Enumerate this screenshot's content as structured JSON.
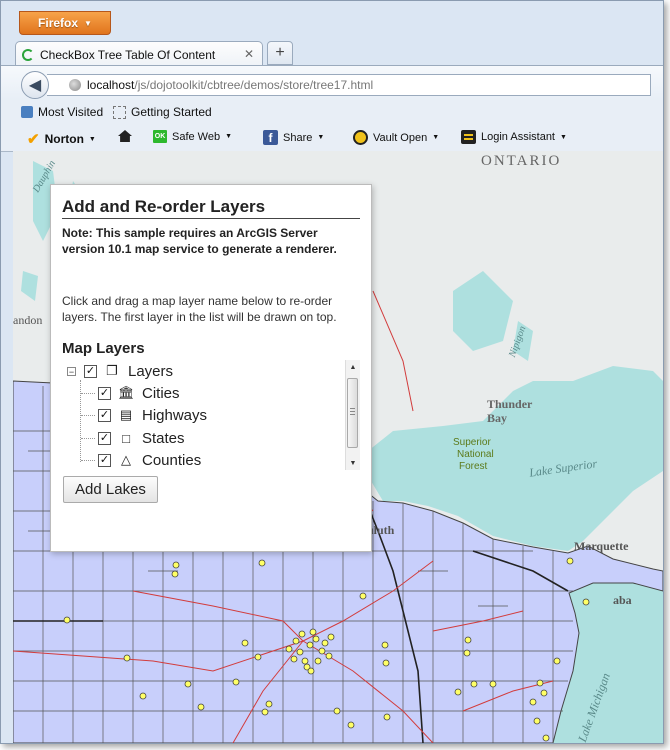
{
  "browser": {
    "menu_button": "Firefox",
    "tab_title": "CheckBox Tree Table Of Content",
    "new_tab_label": "+",
    "url_host": "localhost",
    "url_path": "/js/dojotoolkit/cbtree/demos/store/tree17.html"
  },
  "bookmarks": [
    {
      "label": "Most Visited",
      "icon": "most-visited-icon"
    },
    {
      "label": "Getting Started",
      "icon": "page-icon"
    }
  ],
  "norton_toolbar": {
    "brand": "Norton",
    "items": [
      {
        "label": "Safe Web",
        "icon": "ok-icon"
      },
      {
        "label": "Share",
        "icon": "facebook-icon"
      },
      {
        "label": "Vault Open",
        "icon": "vault-icon"
      },
      {
        "label": "Login Assistant",
        "icon": "login-assistant-icon"
      }
    ]
  },
  "map": {
    "water_color": "#aee0df",
    "county_fill": "#c8cffb",
    "land_color": "#e9ecec",
    "labels": {
      "ontario": "ONTARIO",
      "thunder_bay_1": "Thunder",
      "thunder_bay_2": "Bay",
      "superior_forest_1": "Superior",
      "superior_forest_2": "National",
      "superior_forest_3": "Forest",
      "lake_superior": "Lake Superior",
      "nipigon": "Nipigon",
      "marquette": "Marquette",
      "duluth": "uluth",
      "brandon": "andon",
      "lake_michigan": "Lake Michigan",
      "escanaba": "aba",
      "dauphin": "Dauphin"
    }
  },
  "panel": {
    "title": "Add and Re-order Layers",
    "note": "Note: This sample requires an ArcGIS Server version 10.1 map service to generate a renderer.",
    "instructions": "Click and drag a map layer name below to re-order layers. The first layer in the list will be drawn on top.",
    "layers_heading": "Map Layers",
    "tree": {
      "root": {
        "label": "Layers",
        "checked": true,
        "expanded": true,
        "icon": "layers-icon"
      },
      "children": [
        {
          "label": "Cities",
          "checked": true,
          "icon": "building-icon"
        },
        {
          "label": "Highways",
          "checked": true,
          "icon": "bus-icon"
        },
        {
          "label": "States",
          "checked": true,
          "icon": "square-icon"
        },
        {
          "label": "Counties",
          "checked": true,
          "icon": "triangle-icon"
        }
      ]
    },
    "add_button": "Add Lakes"
  }
}
